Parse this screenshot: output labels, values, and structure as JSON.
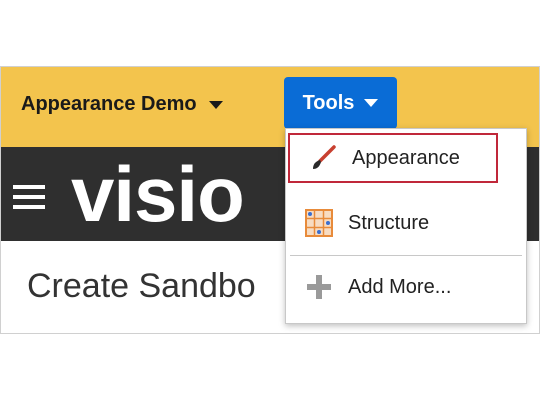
{
  "topbar": {
    "sandbox_name": "Appearance Demo",
    "tools_label": "Tools"
  },
  "brand": {
    "text": "visio"
  },
  "page": {
    "title": "Create Sandbo"
  },
  "tools_menu": {
    "items": [
      {
        "label": "Appearance",
        "icon": "paintbrush-icon"
      },
      {
        "label": "Structure",
        "icon": "structure-grid-icon"
      },
      {
        "label": "Add More...",
        "icon": "plus-icon"
      }
    ]
  },
  "colors": {
    "topbar": "#f3c44d",
    "tools_button": "#0a6cd6",
    "dark_band": "#2f2f2f",
    "highlight_border": "#c0283a"
  }
}
